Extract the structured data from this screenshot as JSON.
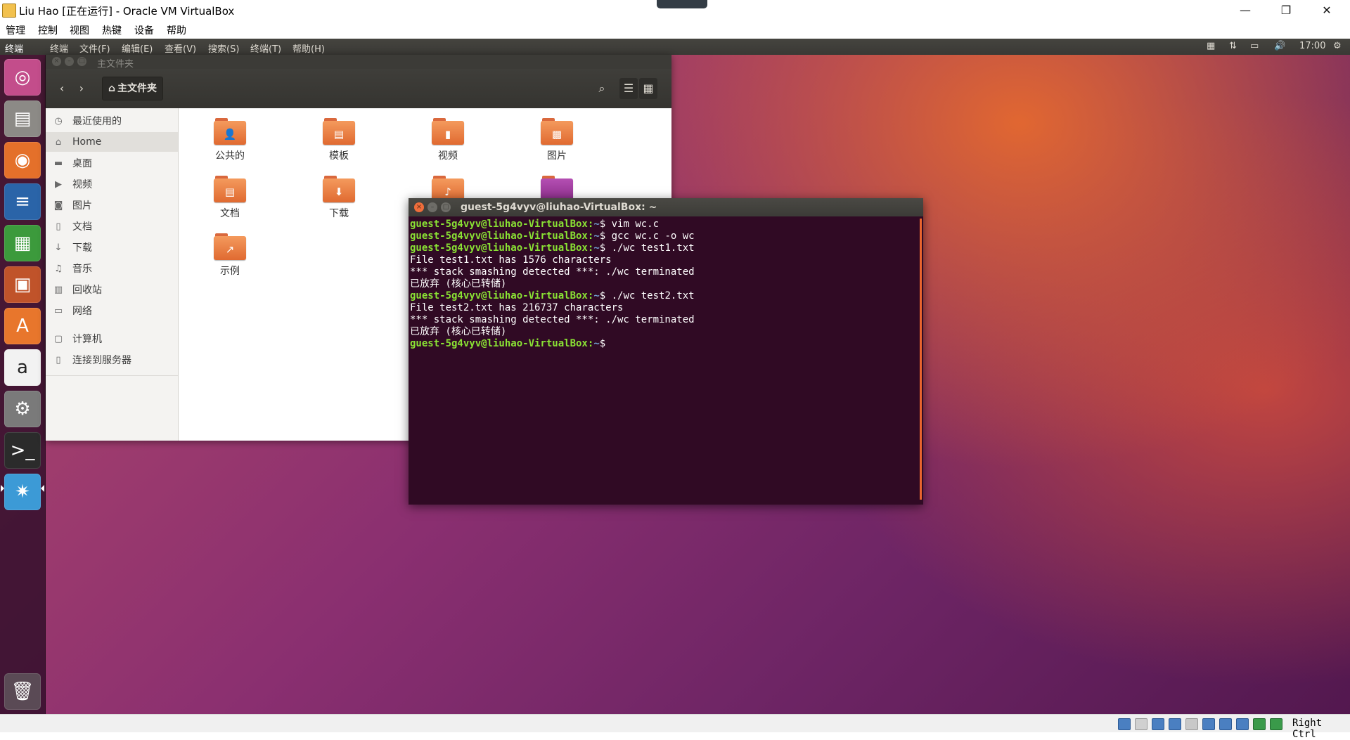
{
  "host": {
    "title": "Liu Hao [正在运行] - Oracle VM VirtualBox",
    "controls": {
      "minimize": "—",
      "restore": "❐",
      "close": "✕"
    },
    "menu": [
      "管理",
      "控制",
      "视图",
      "热键",
      "设备",
      "帮助"
    ],
    "host_key": "Right Ctrl"
  },
  "guest": {
    "panel": {
      "app_title": "终端",
      "menus": [
        "终端",
        "文件(F)",
        "编辑(E)",
        "查看(V)",
        "搜索(S)",
        "终端(T)",
        "帮助(H)"
      ],
      "clock": "17:00"
    },
    "launcher": [
      {
        "name": "dash-icon",
        "glyph": "◎",
        "color": "#c34d8b"
      },
      {
        "name": "files-icon",
        "glyph": "▤",
        "color": "#8c8a86"
      },
      {
        "name": "firefox-icon",
        "glyph": "◉",
        "color": "#e4702a"
      },
      {
        "name": "writer-icon",
        "glyph": "≡",
        "color": "#2a64a8"
      },
      {
        "name": "calc-icon",
        "glyph": "▦",
        "color": "#3c9a3c"
      },
      {
        "name": "impress-icon",
        "glyph": "▣",
        "color": "#c0532a"
      },
      {
        "name": "software-center-icon",
        "glyph": "A",
        "color": "#e8762c"
      },
      {
        "name": "amazon-icon",
        "glyph": "a",
        "color": "#f2f2f2"
      },
      {
        "name": "system-settings-icon",
        "glyph": "⚙",
        "color": "#7a7a7a"
      },
      {
        "name": "terminal-icon",
        "glyph": ">_",
        "color": "#2b2b2b"
      },
      {
        "name": "screenshot-icon",
        "glyph": "✷",
        "color": "#3c9ad6"
      }
    ],
    "trash_glyph": "🗑"
  },
  "nautilus": {
    "window_title": "主文件夹",
    "path_label": "主文件夹",
    "sidebar": [
      {
        "label": "最近使用的",
        "icon": "◷",
        "name": "recent"
      },
      {
        "label": "Home",
        "icon": "⌂",
        "name": "home"
      },
      {
        "label": "桌面",
        "icon": "▬",
        "name": "desktop"
      },
      {
        "label": "视频",
        "icon": "▶",
        "name": "videos"
      },
      {
        "label": "图片",
        "icon": "◙",
        "name": "pictures"
      },
      {
        "label": "文档",
        "icon": "▯",
        "name": "documents"
      },
      {
        "label": "下载",
        "icon": "↓",
        "name": "downloads"
      },
      {
        "label": "音乐",
        "icon": "♫",
        "name": "music"
      },
      {
        "label": "回收站",
        "icon": "▥",
        "name": "trash"
      },
      {
        "label": "网络",
        "icon": "▭",
        "name": "network"
      },
      {
        "label": "计算机",
        "icon": "▢",
        "name": "computer"
      },
      {
        "label": "连接到服务器",
        "icon": "▯",
        "name": "connect-to-server"
      }
    ],
    "files": [
      {
        "label": "公共的",
        "emblem": "👤"
      },
      {
        "label": "模板",
        "emblem": "▤"
      },
      {
        "label": "视频",
        "emblem": "▮"
      },
      {
        "label": "图片",
        "emblem": "▩"
      },
      {
        "label": "文档",
        "emblem": "▤"
      },
      {
        "label": "下载",
        "emblem": "⬇"
      },
      {
        "label": "",
        "emblem": "♪"
      },
      {
        "label": "",
        "emblem": ""
      },
      {
        "label": "示例",
        "emblem": "↗"
      }
    ]
  },
  "terminal": {
    "title": "guest-5g4vyv@liuhao-VirtualBox: ~",
    "prompt_user": "guest-5g4vyv@liuhao-VirtualBox",
    "prompt_path": "~",
    "lines": [
      {
        "type": "cmd",
        "text": "vim wc.c"
      },
      {
        "type": "cmd",
        "text": "gcc wc.c -o wc"
      },
      {
        "type": "cmd",
        "text": "./wc test1.txt"
      },
      {
        "type": "out",
        "text": "File test1.txt has 1576 characters"
      },
      {
        "type": "out",
        "text": "*** stack smashing detected ***: ./wc terminated"
      },
      {
        "type": "out",
        "text": "已放弃 (核心已转储)"
      },
      {
        "type": "cmd",
        "text": "./wc test2.txt"
      },
      {
        "type": "out",
        "text": "File test2.txt has 216737 characters"
      },
      {
        "type": "out",
        "text": "*** stack smashing detected ***: ./wc terminated"
      },
      {
        "type": "out",
        "text": "已放弃 (核心已转储)"
      },
      {
        "type": "cmd",
        "text": ""
      }
    ]
  }
}
